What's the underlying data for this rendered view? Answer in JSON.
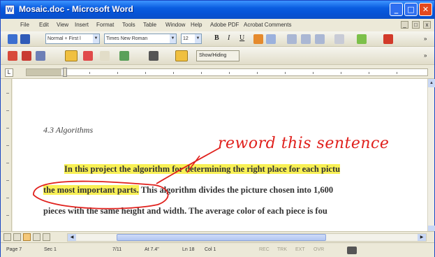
{
  "window": {
    "title": "Mosaic.doc - Microsoft Word",
    "app_icon": "word-doc-icon"
  },
  "menu": [
    "File",
    "Edit",
    "View",
    "Insert",
    "Format",
    "Tools",
    "Table",
    "Window",
    "Help",
    "Adobe PDF",
    "Acrobat Comments"
  ],
  "toolbar": {
    "style": "Normal + First l",
    "font": "Times New Roman",
    "size": "12",
    "show_hide": "Show/Hiding"
  },
  "document": {
    "heading": "4.3  Algorithms",
    "lines": [
      "In this project the algorithm for determining the right place for each pictu",
      "the most important parts.",
      " This algorithm divides the picture chosen into 1,600",
      "pieces with the same height and width.  The average color of each piece is fou"
    ],
    "annotation": "reword this sentence"
  },
  "status": {
    "page": "Page 7",
    "sec": "Sec 1",
    "pages": "7/11",
    "at": "At 7.4\"",
    "ln": "Ln 18",
    "col": "Col 1",
    "modes": [
      "REC",
      "TRK",
      "EXT",
      "OVR"
    ]
  },
  "colors": {
    "titlebar": "#0653d6",
    "highlight": "#f8f055",
    "ink": "#e0201c"
  }
}
